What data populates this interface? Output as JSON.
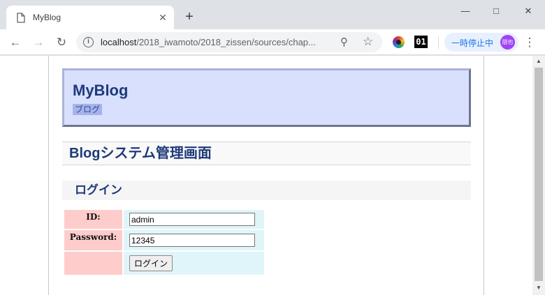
{
  "browser": {
    "tab_title": "MyBlog",
    "tab_close": "✕",
    "new_tab": "+",
    "url_host": "localhost",
    "url_path": "/2018_iwamoto/2018_zissen/sources/chap...",
    "profile_text": "一時停止中",
    "avatar_text": "朋也",
    "ext2_text": "01"
  },
  "header": {
    "site_title": "MyBlog",
    "blog_link": "ブログ"
  },
  "page": {
    "title": "Blogシステム管理画面",
    "section": "ログイン"
  },
  "form": {
    "id_label": "ID:",
    "id_value": "admin",
    "password_label": "Password:",
    "password_value": "12345",
    "submit_label": "ログイン"
  },
  "colors": {
    "header_bg": "#d8e0fe",
    "title_color": "#1f3a7a",
    "label_bg": "#ffcccc",
    "field_bg": "#e0f5fa"
  }
}
